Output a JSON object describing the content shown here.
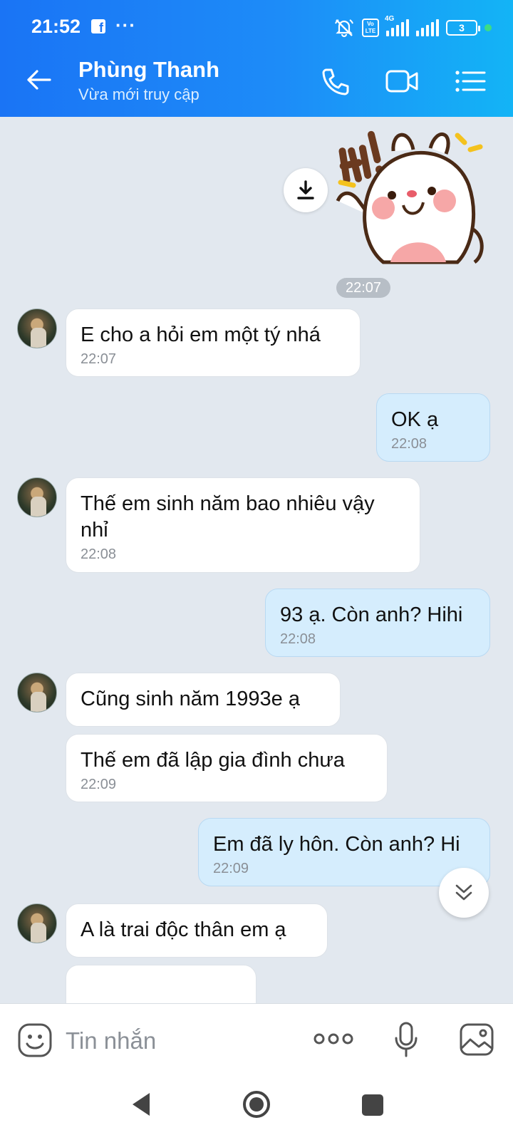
{
  "status_bar": {
    "time": "21:52",
    "battery": "3",
    "network_label": "4G",
    "volte_label": "Vo LTE"
  },
  "header": {
    "contact_name": "Phùng Thanh",
    "status": "Vừa mới truy cập"
  },
  "chat": {
    "sticker_time": "22:07",
    "messages": [
      {
        "text": "E cho a hỏi em một tý nhá",
        "time": "22:07"
      },
      {
        "text": "OK ạ",
        "time": "22:08"
      },
      {
        "text": "Thế em sinh năm bao nhiêu vậy nhỉ",
        "time": "22:08"
      },
      {
        "text": "93 ạ. Còn anh? Hihi",
        "time": "22:08"
      },
      {
        "text": "Cũng sinh năm 1993e ạ",
        "time": ""
      },
      {
        "text": "Thế em đã lập gia đình chưa",
        "time": "22:09"
      },
      {
        "text": "Em đã ly hôn. Còn anh? Hi",
        "time": "22:09"
      },
      {
        "text": "A là trai độc thân em ạ",
        "time": ""
      }
    ]
  },
  "input": {
    "placeholder": "Tin nhắn"
  },
  "colors": {
    "header_start": "#1a74f5",
    "header_end": "#13b4f6",
    "chat_bg": "#e2e8ef",
    "out_bubble": "#d5edfd",
    "in_bubble": "#ffffff"
  }
}
